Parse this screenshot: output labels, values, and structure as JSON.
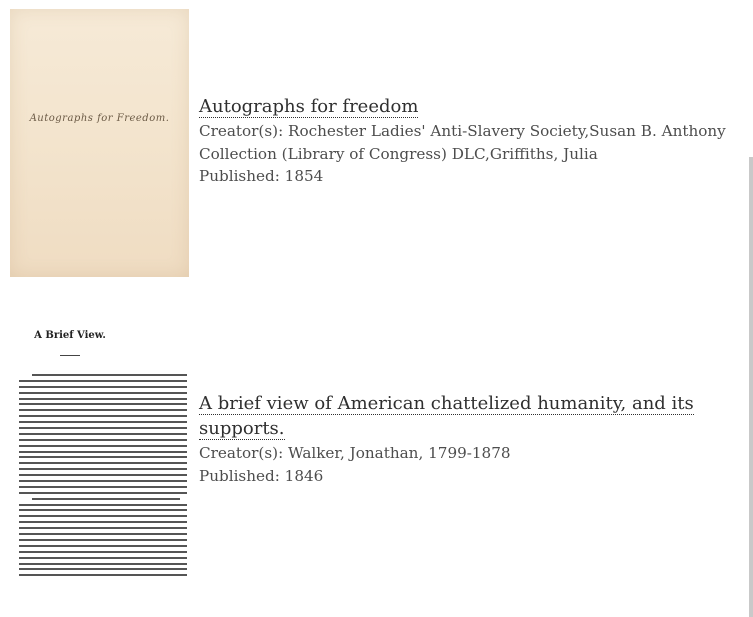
{
  "results": [
    {
      "title": "Autographs for freedom",
      "creators_label": "Creator(s):",
      "creators": "Rochester Ladies' Anti-Slavery Society,Susan B. Anthony Collection (Library of Congress) DLC,Griffiths, Julia",
      "published_label": "Published:",
      "published": "1854",
      "thumbnail_text": "Autographs for Freedom."
    },
    {
      "title": "A brief view of American chattelized humanity, and its supports.",
      "creators_label": "Creator(s):",
      "creators": "Walker, Jonathan, 1799-1878",
      "published_label": "Published:",
      "published": "1846",
      "thumbnail_heading": "A Brief View."
    }
  ]
}
